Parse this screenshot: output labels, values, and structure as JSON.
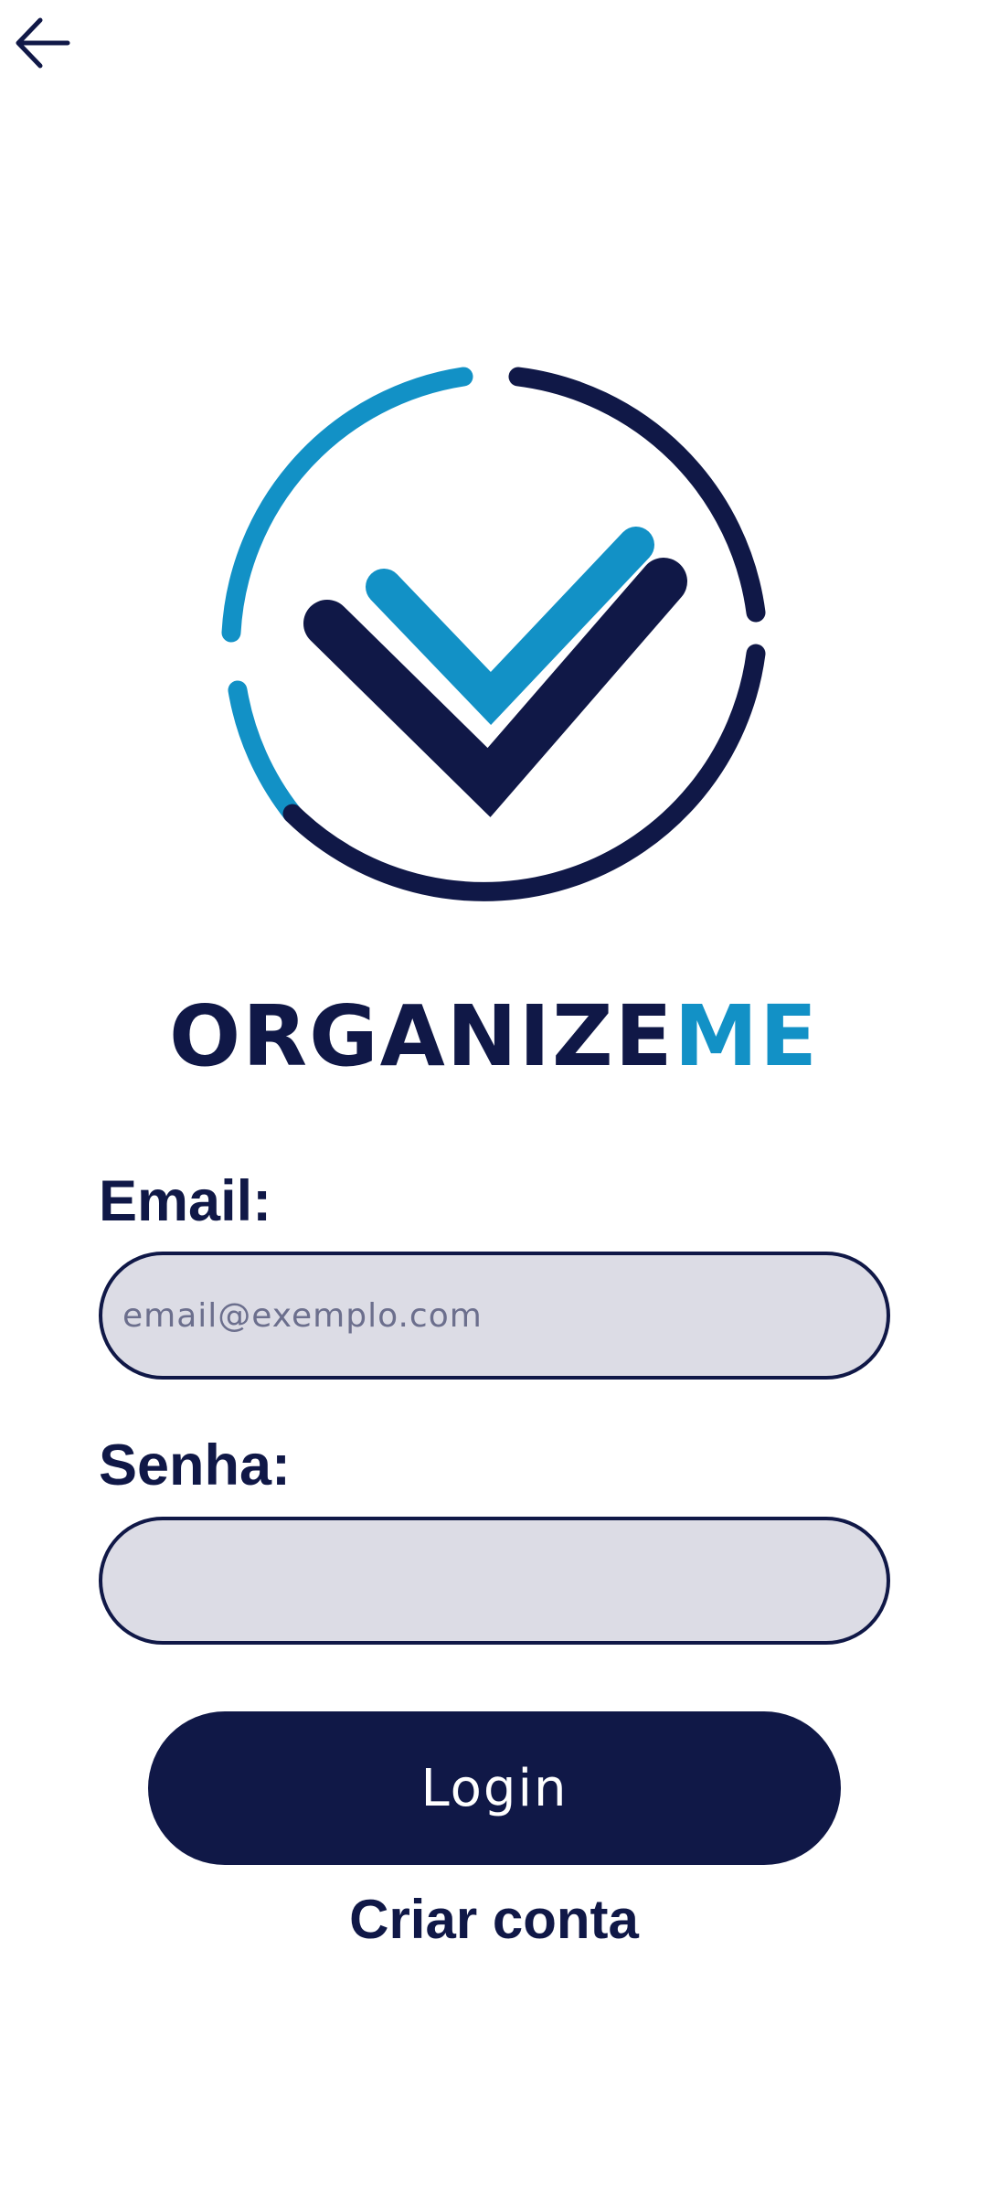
{
  "header": {
    "back_icon": "arrow-left-icon"
  },
  "logo": {
    "icon": "checkmark-circle-logo",
    "brand_part1": "ORGANIZE",
    "brand_part2": "ME",
    "colors": {
      "dark": "#101847",
      "blue": "#1291c6"
    }
  },
  "form": {
    "email_label": "Email:",
    "email_value": "",
    "email_placeholder": "email@exemplo.com",
    "password_label": "Senha:",
    "password_value": "",
    "login_label": "Login",
    "create_account_label": "Criar conta"
  }
}
